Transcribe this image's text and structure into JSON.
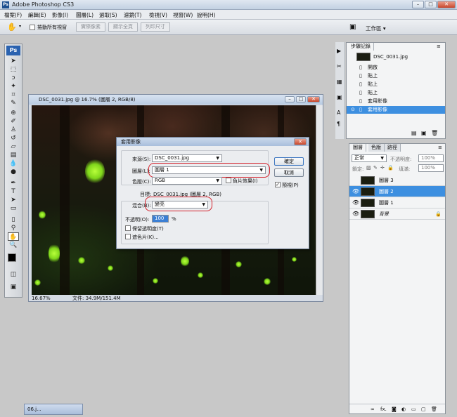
{
  "app": {
    "title": "Adobe Photoshop CS3",
    "logo": "Ps"
  },
  "window_buttons": [
    "–",
    "□",
    "✕"
  ],
  "menu": [
    "檔案(F)",
    "編輯(E)",
    "影像(I)",
    "圖層(L)",
    "選取(S)",
    "濾鏡(T)",
    "檢視(V)",
    "視窗(W)",
    "說明(H)"
  ],
  "options_bar": {
    "scroll_all_windows": "捲動所有視窗",
    "actual_pixels": "實際像素",
    "fit_screen": "顯示全頁",
    "print_size": "列印尺寸",
    "workspace": "工作區 ▾"
  },
  "document": {
    "title": "DSC_0031.jpg @ 16.7% (圖層 2, RGB/8)",
    "zoom": "16.67%",
    "file_info": "文件: 34.9M/151.4M"
  },
  "dialog": {
    "title": "套用影像",
    "source_label": "來源(S):",
    "source_value": "DSC_0031.jpg",
    "layer_label": "圖層(L):",
    "layer_value": "圖層 1",
    "channel_label": "色版(C):",
    "channel_value": "RGB",
    "invert_label": "負片效果(I)",
    "target_label": "目標:",
    "target_value": "DSC_0031.jpg (圖層 2, RGB)",
    "blending_label": "混合(B):",
    "blending_value": "變亮",
    "opacity_label": "不透明(O):",
    "opacity_value": "100",
    "opacity_unit": "%",
    "preserve_transparency": "保留透明度(T)",
    "mask_label": "遮色片(K)...",
    "ok_label": "確定",
    "cancel_label": "取消",
    "preview_label": "預視(P)"
  },
  "history_panel": {
    "tab": "步驟記錄",
    "snapshot": "DSC_0031.jpg",
    "steps": [
      "開啟",
      "貼上",
      "貼上",
      "貼上",
      "套用影像",
      "套用影像"
    ],
    "selected_index": 5
  },
  "layers_panel": {
    "tabs": [
      "圖層",
      "色版",
      "路徑"
    ],
    "blend_mode": "正常",
    "opacity_label": "不透明度:",
    "opacity_value": "100%",
    "lock_label": "鎖定:",
    "fill_label": "填滿:",
    "fill_value": "100%",
    "layers": [
      {
        "name": "圖層 3",
        "visible": false,
        "selected": false
      },
      {
        "name": "圖層 2",
        "visible": true,
        "selected": true
      },
      {
        "name": "圖層 1",
        "visible": true,
        "selected": false
      },
      {
        "name": "背景",
        "visible": true,
        "selected": false,
        "locked": true
      }
    ],
    "footer_icons": [
      "link-icon",
      "fx-icon",
      "mask-icon",
      "adjustment-icon",
      "folder-icon",
      "new-layer-icon",
      "trash-icon"
    ]
  },
  "taskbar_doc": {
    "label": "06.j..."
  }
}
